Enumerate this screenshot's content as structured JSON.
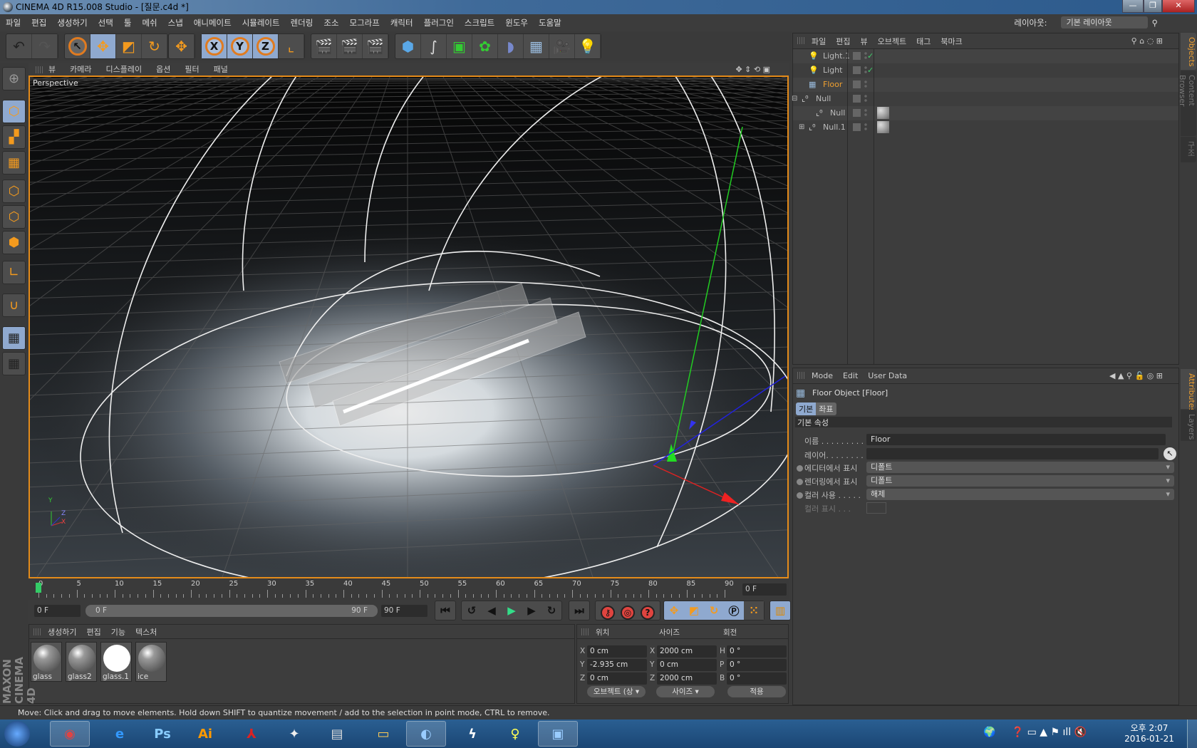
{
  "window": {
    "title": "CINEMA 4D R15.008 Studio - [질문.c4d *]",
    "minimize": "—",
    "restore": "❐",
    "close": "✕"
  },
  "menu": [
    "파일",
    "편집",
    "생성하기",
    "선택",
    "툴",
    "메쉬",
    "스냅",
    "애니메이트",
    "시뮬레이트",
    "렌더링",
    "조소",
    "모그라프",
    "캐릭터",
    "플러그인",
    "스크립트",
    "윈도우",
    "도움말"
  ],
  "layout": {
    "label": "레이아웃:",
    "value": "기본 레이아웃"
  },
  "toolbar": {
    "axis_x": "X",
    "axis_y": "Y",
    "axis_z": "Z"
  },
  "viewport": {
    "menu": [
      "뷰",
      "카메라",
      "디스플레이",
      "옵션",
      "필터",
      "패널"
    ],
    "label": "Perspective",
    "axis_x": "X",
    "axis_y": "Y",
    "axis_z": "Z"
  },
  "timeline": {
    "ticks": [
      "0",
      "5",
      "10",
      "15",
      "20",
      "25",
      "30",
      "35",
      "40",
      "45",
      "50",
      "55",
      "60",
      "65",
      "70",
      "75",
      "80",
      "85",
      "90"
    ],
    "current": "0 F",
    "start": "0 F",
    "range_start": "0 F",
    "range_end": "90 F",
    "end": "90 F"
  },
  "materials": {
    "menu": [
      "생성하기",
      "편집",
      "기능",
      "텍스처"
    ],
    "items": [
      {
        "name": "glass"
      },
      {
        "name": "glass2"
      },
      {
        "name": "glass.1"
      },
      {
        "name": "ice"
      }
    ]
  },
  "coords": {
    "headers": [
      "위치",
      "사이즈",
      "회전"
    ],
    "rows": [
      {
        "pl": "X",
        "pos": "0 cm",
        "sl": "X",
        "size": "2000 cm",
        "rl": "H",
        "rot": "0 °"
      },
      {
        "pl": "Y",
        "pos": "-2.935 cm",
        "sl": "Y",
        "size": "0 cm",
        "rl": "P",
        "rot": "0 °"
      },
      {
        "pl": "Z",
        "pos": "0 cm",
        "sl": "Z",
        "size": "2000 cm",
        "rl": "B",
        "rot": "0 °"
      }
    ],
    "mode": "오브젝트 (상",
    "size_mode": "사이즈",
    "apply": "적용"
  },
  "brand": "MAXON CINEMA 4D",
  "status": "Move: Click and drag to move elements. Hold down SHIFT to quantize movement / add to the selection in point mode, CTRL to remove.",
  "objects": {
    "menu": [
      "파일",
      "편집",
      "뷰",
      "오브젝트",
      "태그",
      "북마크"
    ],
    "items": [
      {
        "name": "Light.1",
        "icon": "light-bulb-icon",
        "check": "✓"
      },
      {
        "name": "Light",
        "icon": "light-bulb-icon",
        "check": "✓"
      },
      {
        "name": "Floor",
        "icon": "floor-icon",
        "selected": true
      },
      {
        "name": "Null",
        "icon": "null-icon",
        "expander": "⊟"
      },
      {
        "name": "Null",
        "icon": "null-icon",
        "tag": "material"
      },
      {
        "name": "Null.1",
        "icon": "null-icon",
        "expander": "⊞",
        "tag": "material"
      }
    ],
    "tabs": [
      "Objects",
      "Content Browser",
      "구조"
    ]
  },
  "attributes": {
    "menu": [
      "Mode",
      "Edit",
      "User Data"
    ],
    "title": "Floor Object [Floor]",
    "tabs": [
      "기본",
      "좌표"
    ],
    "section": "기본 속성",
    "name_label": "이름 . . . . . . . . .",
    "name_value": "Floor",
    "layer_label": "레이어. . . . . . . . .",
    "editor_label": "에디터에서 표시",
    "editor_value": "디폴트",
    "render_label": "렌더링에서 표시",
    "render_value": "디폴트",
    "color_label": "컬러 사용 . . . . .",
    "color_value": "해제",
    "display_color_label": "컬러 표시 . . .",
    "side_tabs": [
      "Attributes",
      "Layers"
    ]
  },
  "tray": {
    "time": "오후 2:07",
    "date": "2016-01-21"
  },
  "taskbar": [
    {
      "name": "chrome",
      "label": "◉"
    },
    {
      "name": "ie",
      "label": "e"
    },
    {
      "name": "photoshop",
      "label": "Ps"
    },
    {
      "name": "illustrator",
      "label": "Ai"
    },
    {
      "name": "acrobat",
      "label": "⅄"
    },
    {
      "name": "rhino",
      "label": "✦"
    },
    {
      "name": "doc",
      "label": "▤"
    },
    {
      "name": "explorer",
      "label": "▭"
    },
    {
      "name": "cinema4d",
      "label": "◐"
    },
    {
      "name": "app-bolt",
      "label": "ϟ"
    },
    {
      "name": "app-bulb",
      "label": "♀"
    },
    {
      "name": "photo-viewer",
      "label": "▣"
    }
  ],
  "colors": {
    "accent": "#e48b1a",
    "selected_tool": "#8fa9cf",
    "object_selected": "#f0a030",
    "check": "#3fd06a"
  }
}
